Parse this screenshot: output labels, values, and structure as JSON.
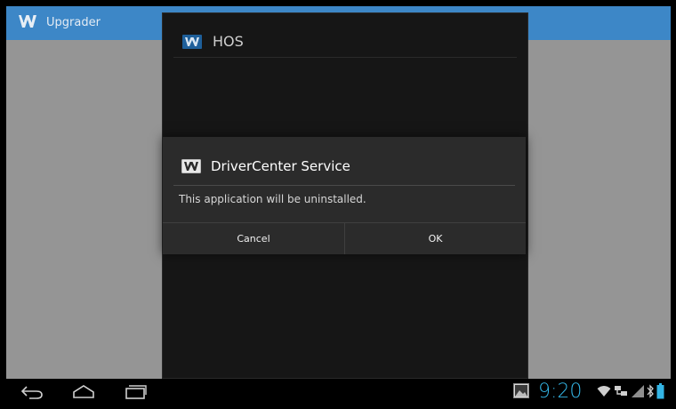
{
  "app_bar": {
    "title": "Upgrader",
    "logo_icon": "w-logo-icon",
    "color": "#3d87c7"
  },
  "hos_dialog": {
    "title": "HOS",
    "logo_icon": "w-logo-icon"
  },
  "service_dialog": {
    "title": "DriverCenter Service",
    "message": "This application will be uninstalled.",
    "cancel_label": "Cancel",
    "ok_label": "OK",
    "logo_icon": "w-logo-icon"
  },
  "status_bar": {
    "time": "9:20",
    "clock_color": "#33b5e5",
    "icons": [
      "gallery-icon",
      "wifi-icon",
      "network-icon",
      "signal-icon",
      "bluetooth-icon",
      "battery-icon"
    ]
  },
  "nav_bar": {
    "icons": [
      "back-icon",
      "home-icon",
      "recents-icon"
    ]
  }
}
